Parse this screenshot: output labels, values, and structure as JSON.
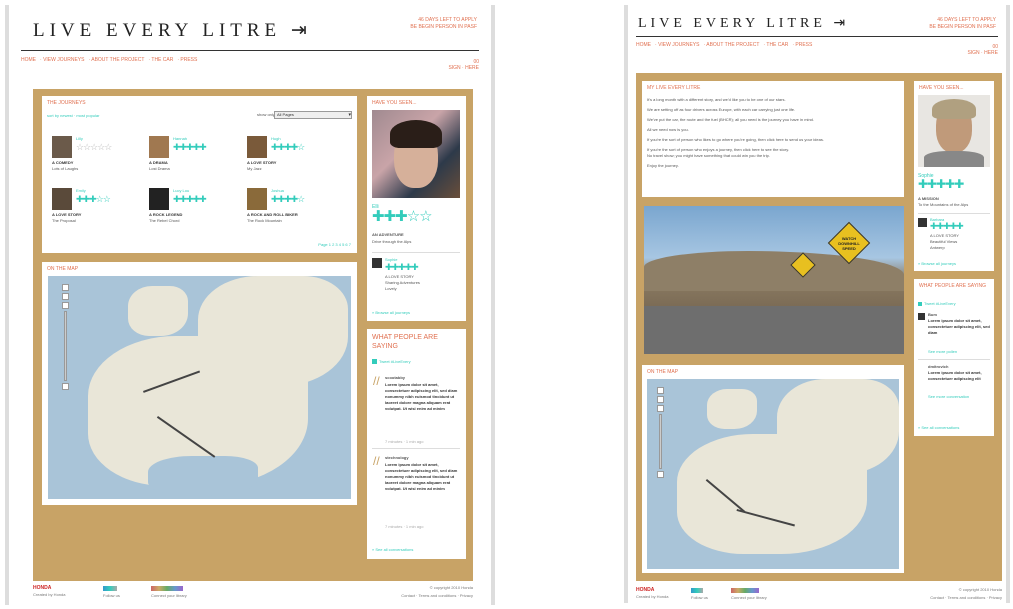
{
  "site": {
    "logo": "LIVE EVERY LITRE",
    "days_left": "46 DAYS LEFT TO APPLY",
    "apply": "BE BEGIN PERSON IN PASF"
  },
  "nav": {
    "items": [
      "HOME",
      "VIEW JOURNEYS",
      "ABOUT THE PROJECT",
      "THE CAR",
      "PRESS"
    ],
    "right1": "00",
    "right2": "SIGN · HERE"
  },
  "page1": {
    "journeys": {
      "title": "THE JOURNEYS",
      "sort": "sort by newest · most popular",
      "filter": "show only",
      "select": "All Pages",
      "users": [
        {
          "name": "Lilly",
          "genre": "A COMEDY",
          "trip": "Lots of Laughs",
          "stars": "☆☆☆☆☆"
        },
        {
          "name": "Hannah",
          "genre": "A DRAMA",
          "trip": "Lost Drama",
          "stars": "✚✚✚✚✚"
        },
        {
          "name": "Hugh",
          "genre": "A LOVE STORY",
          "trip": "My Jazz",
          "stars": "✚✚✚✚☆"
        },
        {
          "name": "Emily",
          "genre": "A LOVE STORY",
          "trip": "The Proposal",
          "stars": "✚✚✚☆☆"
        },
        {
          "name": "Lucy Lou",
          "genre": "A ROCK LEGEND",
          "trip": "The Rebel Chord",
          "stars": "✚✚✚✚✚"
        },
        {
          "name": "Joshua",
          "genre": "A ROCK AND ROLL BIKER",
          "trip": "The Rock Mountain",
          "stars": "✚✚✚✚☆"
        }
      ],
      "pager": "Page 1 2 3 4 5 6 7"
    },
    "map": {
      "title": "ON THE MAP"
    },
    "have": {
      "title": "HAVE YOU SEEN...",
      "name": "Elli",
      "stars": "✚✚✚☆☆",
      "genre": "AN ADVENTURE",
      "trip": "Drive through the Alps",
      "user2": "Sophie",
      "u2stars": "✚✚✚✚✚",
      "u2trip": "A LOVE STORY",
      "u2sub": "Sharing Adventures",
      "u2more": "Lovely",
      "link": "» Browse all journeys"
    },
    "saying": {
      "title": "WHAT PEOPLE ARE SAYING",
      "tweet": "Tweet #LiveEvery",
      "posts": [
        {
          "user": "scootabby",
          "text": "Lorem ipsum dolor sit amet, consectetuer adipiscing elit, sed diam nonummy nibh euismod tincidunt ut laoreet dolore magna aliquam erat volutpat. Ut wisi enim ad minim",
          "time": "7 minutes · 1 min ago"
        },
        {
          "user": "stechnology",
          "text": "Lorem ipsum dolor sit amet, consectetuer adipiscing elit, sed diam nonummy nibh euismod tincidunt ut laoreet dolore magna aliquam erat volutpat. Ut wisi enim ad minim",
          "time": "7 minutes · 1 min ago"
        }
      ],
      "link": "» See all conversations"
    }
  },
  "page2": {
    "message": {
      "title": "MY LIVE EVERY LITRE",
      "lines": [
        "It's a long month with a different story, and we'd like you to be one of our stars.",
        "We are setting off as four drivers across Europe, with each car carrying just one life.",
        "We've put the car, the route and the fuel (BHCR); all you need is the journey you have in mind.",
        "All we need now is you.",
        "If you're the sort of person who likes to go where you're going, then click here to send us your ideas.",
        "If you're the sort of person who enjoys a journey, then click here to see the story.",
        "No travel show; you might have something that could win you the trip.",
        "Enjoy the journey."
      ]
    },
    "photo_sign": "WATCH DOWNHILL SPEED",
    "map": {
      "title": "ON THE MAP"
    },
    "have": {
      "title": "HAVE YOU SEEN...",
      "name": "Sophie",
      "stars": "✚✚✚✚✚",
      "genre": "A MISSION",
      "trip": "To the Mountains of the Alps",
      "user2": "Barbara",
      "u2stars": "✚✚✚✚✚",
      "u2trip": "A LOVE STORY",
      "u2sub": "Beautiful Views",
      "u2more": "Antwerp",
      "link": "» Browse all journeys"
    },
    "saying": {
      "title": "WHAT PEOPLE ARE SAYING",
      "tweet": "Tweet #LiveEvery",
      "posts": [
        {
          "user": "Bum",
          "text": "Lorem ipsum dolor sit amet, consectetuer adipiscing elit, sed diam",
          "time": "See more pollen"
        },
        {
          "user": "dmitrovich",
          "text": "Lorem ipsum dolor sit amet, consectetuer adipiscing elit",
          "time": "See more conversation"
        }
      ],
      "link": "» See all conversations"
    }
  },
  "footer": {
    "brand": "HONDA",
    "tag": "Created by Honda",
    "follow": "Follow us",
    "share": "Connect your library",
    "copy": "© copyright 2010 Honda",
    "links": "Contact · Terms and conditions · Privacy"
  }
}
